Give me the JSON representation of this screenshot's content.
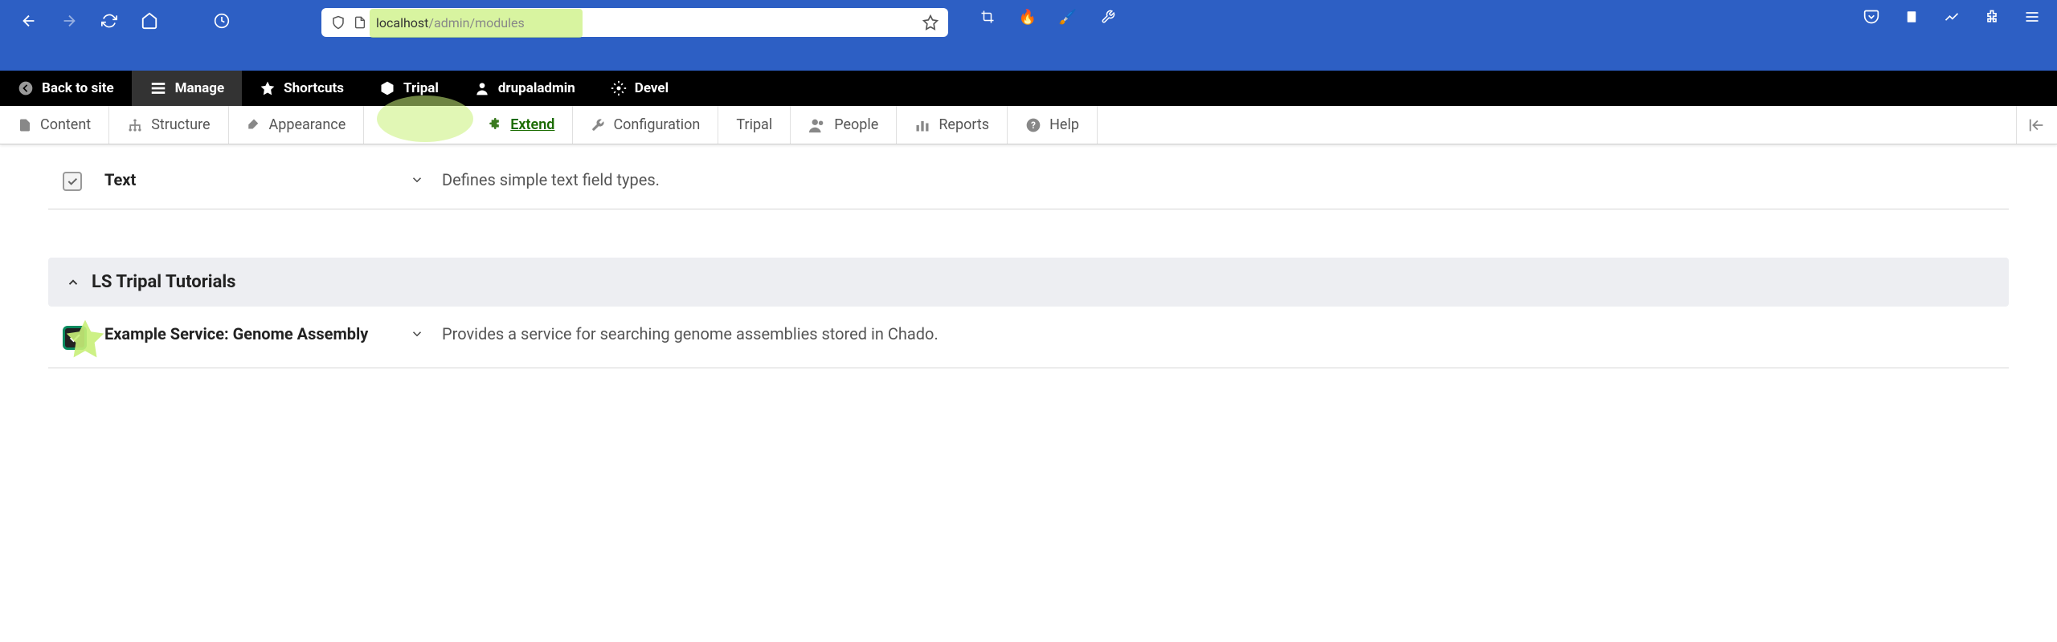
{
  "browser": {
    "url_host": "localhost",
    "url_path": "/admin/modules"
  },
  "toolbar_top": {
    "back": "Back to site",
    "manage": "Manage",
    "shortcuts": "Shortcuts",
    "tripal": "Tripal",
    "user": "drupaladmin",
    "devel": "Devel"
  },
  "toolbar_sec": {
    "content": "Content",
    "structure": "Structure",
    "appearance": "Appearance",
    "extend": "Extend",
    "configuration": "Configuration",
    "tripal": "Tripal",
    "people": "People",
    "reports": "Reports",
    "help": "Help"
  },
  "modules": {
    "text": {
      "name": "Text",
      "desc": "Defines simple text field types."
    },
    "group_title": "LS Tripal Tutorials",
    "genome": {
      "name": "Example Service: Genome Assembly",
      "desc": "Provides a service for searching genome assemblies stored in Chado."
    }
  }
}
